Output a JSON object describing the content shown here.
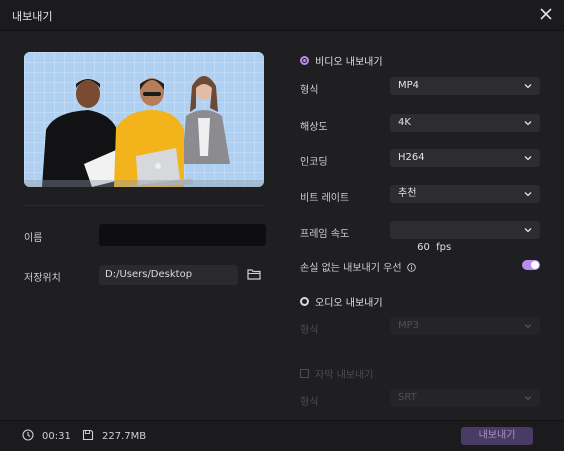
{
  "window": {
    "title": "내보내기"
  },
  "form": {
    "name_label": "이름",
    "name_value": "",
    "location_label": "저장위치",
    "location_value": "D:/Users/Desktop"
  },
  "video": {
    "section_label": "비디오 내보내기",
    "format_label": "형식",
    "format_value": "MP4",
    "resolution_label": "해상도",
    "resolution_value": "4K",
    "encoding_label": "인코딩",
    "encoding_value": "H264",
    "bitrate_label": "비트 레이트",
    "bitrate_value": "추천",
    "framerate_label": "프레임 속도",
    "framerate_value": "60  fps",
    "lossless_label": "손실 없는 내보내기 우선",
    "lossless_on": true
  },
  "audio": {
    "section_label": "오디오 내보내기",
    "format_label": "형식",
    "format_value": "MP3"
  },
  "subtitle": {
    "section_label": "자막 내보내기",
    "format_label": "형식",
    "format_value": "SRT"
  },
  "footer": {
    "duration": "00:31",
    "size": "227.7MB",
    "export_label": "내보내기"
  },
  "colors": {
    "accent": "#b98cf2",
    "export_button": "#4a3a66"
  }
}
